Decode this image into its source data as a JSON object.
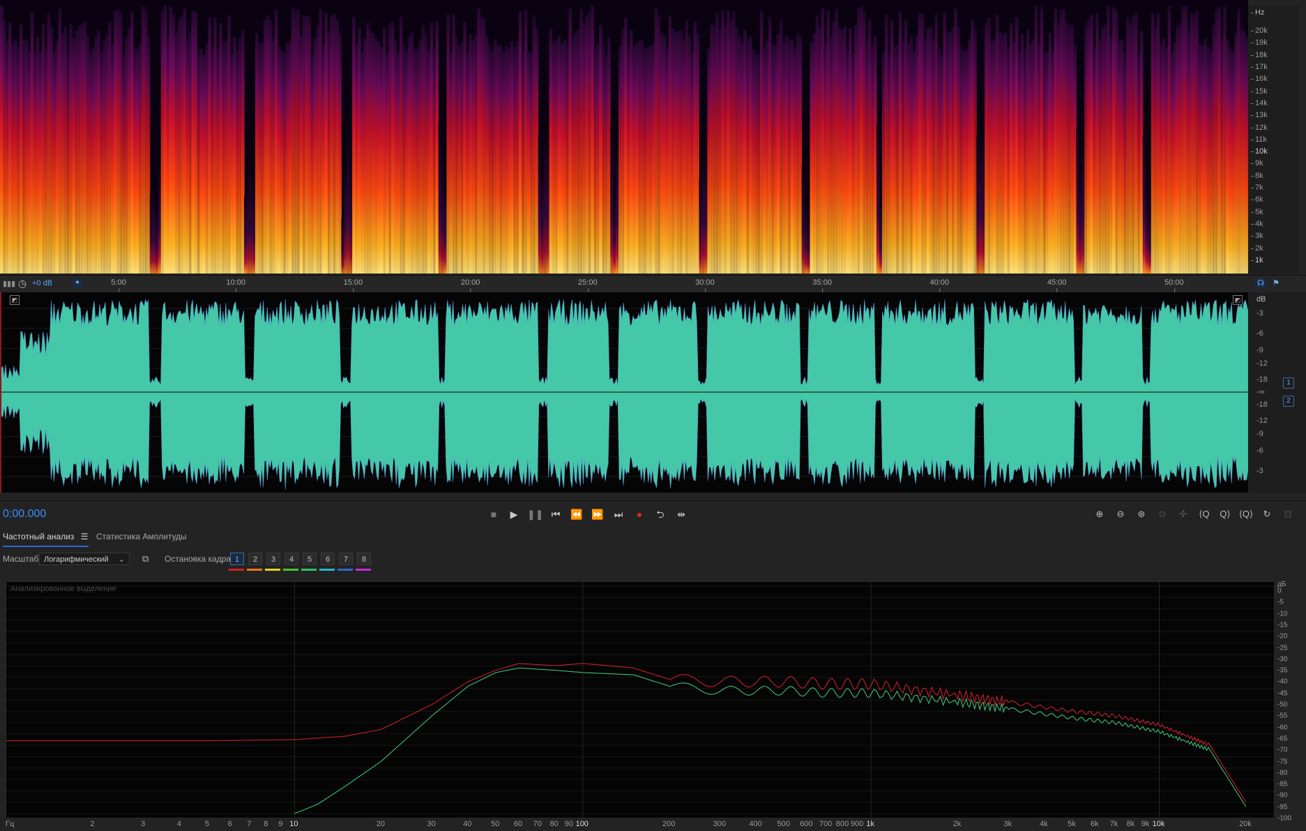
{
  "spectrogram": {
    "unit": "Hz",
    "ticks": [
      "20k",
      "19k",
      "18k",
      "17k",
      "16k",
      "15k",
      "14k",
      "13k",
      "12k",
      "11k",
      "10k",
      "9k",
      "8k",
      "7k",
      "6k",
      "5k",
      "4k",
      "3k",
      "2k",
      "1k"
    ]
  },
  "ruler": {
    "gain_label": "+0 dB",
    "times": [
      "5:00",
      "10:00",
      "15:00",
      "20:00",
      "25:00",
      "30:00",
      "35:00",
      "40:00",
      "45:00",
      "50:00"
    ]
  },
  "waveform": {
    "unit": "dB",
    "ticks": [
      "-3",
      "-6",
      "-9",
      "-12",
      "-18",
      "-∞",
      "-18",
      "-12",
      "-9",
      "-6",
      "-3"
    ],
    "channels": [
      "1",
      "2"
    ],
    "color": "#44c8a8"
  },
  "transport": {
    "timecode": "0:00.000",
    "buttons": [
      "stop-icon",
      "play-icon",
      "pause-icon",
      "skip-start-icon",
      "rewind-icon",
      "fast-forward-icon",
      "skip-end-icon",
      "record-icon",
      "loop-icon",
      "skip-icon"
    ]
  },
  "panel": {
    "tabs": [
      "Частотный анализ",
      "Статистика Амплитуды"
    ],
    "scale_label": "Масштаб:",
    "scale_value": "Логарифмический",
    "freeze_label": "Остановка кадра:",
    "frames": [
      "1",
      "2",
      "3",
      "4",
      "5",
      "6",
      "7",
      "8"
    ],
    "frame_colors": [
      "#d42020",
      "#e87a1e",
      "#e8d31e",
      "#4cc42a",
      "#2ec46e",
      "#2ab4d4",
      "#2a6bd0",
      "#c42ad4"
    ],
    "graph_caption": "Анализированное выделение",
    "x_unit": "Гц",
    "y_unit": "дБ",
    "x_ticks": [
      "2",
      "3",
      "4",
      "5",
      "6",
      "7",
      "8",
      "9",
      "10",
      "20",
      "30",
      "40",
      "50",
      "60",
      "70",
      "80",
      "90",
      "100",
      "200",
      "300",
      "400",
      "500",
      "600",
      "700",
      "800",
      "900",
      "1k",
      "2k",
      "3k",
      "4k",
      "5k",
      "6k",
      "7k",
      "8k",
      "9k",
      "10k",
      "20k"
    ],
    "y_ticks": [
      "0",
      "-5",
      "-10",
      "-15",
      "-20",
      "-25",
      "-30",
      "-35",
      "-40",
      "-45",
      "-50",
      "-55",
      "-60",
      "-65",
      "-70",
      "-75",
      "-80",
      "-85",
      "-90",
      "-95",
      "-100"
    ]
  },
  "chart_data": {
    "type": "line",
    "xlabel": "Гц",
    "ylabel": "дБ",
    "x_scale": "log",
    "xlim": [
      1,
      25000
    ],
    "ylim": [
      -100,
      0
    ],
    "series": [
      {
        "color": "#c8202a",
        "x": [
          1,
          5,
          10,
          15,
          20,
          30,
          40,
          50,
          60,
          80,
          100,
          150,
          200,
          300,
          500,
          700,
          1000,
          2000,
          3000,
          5000,
          7000,
          10000,
          15000,
          20000
        ],
        "y": [
          -68,
          -68,
          -67.5,
          -66,
          -63,
          -52,
          -42,
          -37,
          -34,
          -35,
          -34,
          -36,
          -41,
          -42,
          -42,
          -43,
          -43,
          -48,
          -51,
          -55,
          -57,
          -61,
          -70,
          -95
        ]
      },
      {
        "color": "#3fbf7a",
        "x": [
          10,
          12,
          15,
          20,
          30,
          40,
          50,
          60,
          80,
          100,
          150,
          200,
          300,
          500,
          700,
          1000,
          2000,
          3000,
          5000,
          7000,
          10000,
          15000,
          20000
        ],
        "y": [
          -100,
          -96,
          -88,
          -77,
          -57,
          -44,
          -38,
          -36,
          -37,
          -38,
          -39,
          -44,
          -46,
          -46,
          -47,
          -47,
          -51,
          -54,
          -58,
          -60,
          -64,
          -72,
          -97
        ]
      }
    ]
  }
}
